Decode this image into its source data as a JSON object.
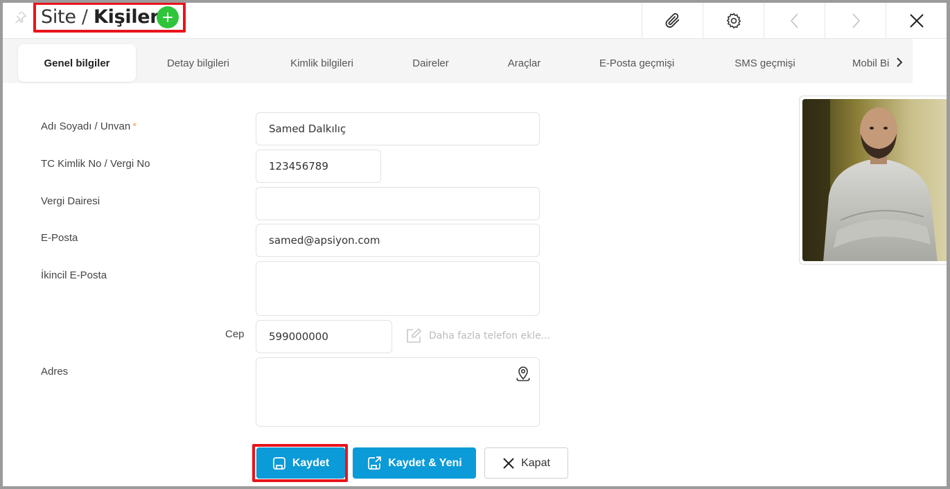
{
  "header": {
    "breadcrumb_parent": "Site",
    "breadcrumb_sep": " / ",
    "breadcrumb_current": "Kişiler",
    "add_symbol": "+"
  },
  "toolbar": {
    "icons": [
      "paperclip-icon",
      "gear-icon",
      "chevron-left-icon",
      "chevron-right-icon",
      "close-icon"
    ]
  },
  "tabs": [
    {
      "label": "Genel bilgiler",
      "active": true
    },
    {
      "label": "Detay bilgileri",
      "active": false
    },
    {
      "label": "Kimlik bilgileri",
      "active": false
    },
    {
      "label": "Daireler",
      "active": false
    },
    {
      "label": "Araçlar",
      "active": false
    },
    {
      "label": "E-Posta geçmişi",
      "active": false
    },
    {
      "label": "SMS geçmişi",
      "active": false
    },
    {
      "label": "Mobil Bi",
      "active": false
    }
  ],
  "form": {
    "name_label": "Adı Soyadı / Unvan",
    "required_mark": "*",
    "name_value": "Samed Dalkılıç",
    "tc_label": "TC Kimlik No / Vergi No",
    "tc_value": "123456789",
    "tax_office_label": "Vergi Dairesi",
    "tax_office_value": "",
    "email_label": "E-Posta",
    "email_value": "samed@apsiyon.com",
    "email2_label": "İkincil E-Posta",
    "email2_value": "",
    "mobile_label": "Cep",
    "mobile_value": "599000000",
    "more_phone_text": "Daha fazla telefon ekle...",
    "address_label": "Adres",
    "address_value": ""
  },
  "buttons": {
    "save": "Kaydet",
    "save_new": "Kaydet & Yeni",
    "close": "Kapat"
  },
  "colors": {
    "accent_blue": "#0b9bd8",
    "add_green": "#2fc53b",
    "highlight_red": "#e8141b",
    "required_orange": "#f0a060"
  }
}
